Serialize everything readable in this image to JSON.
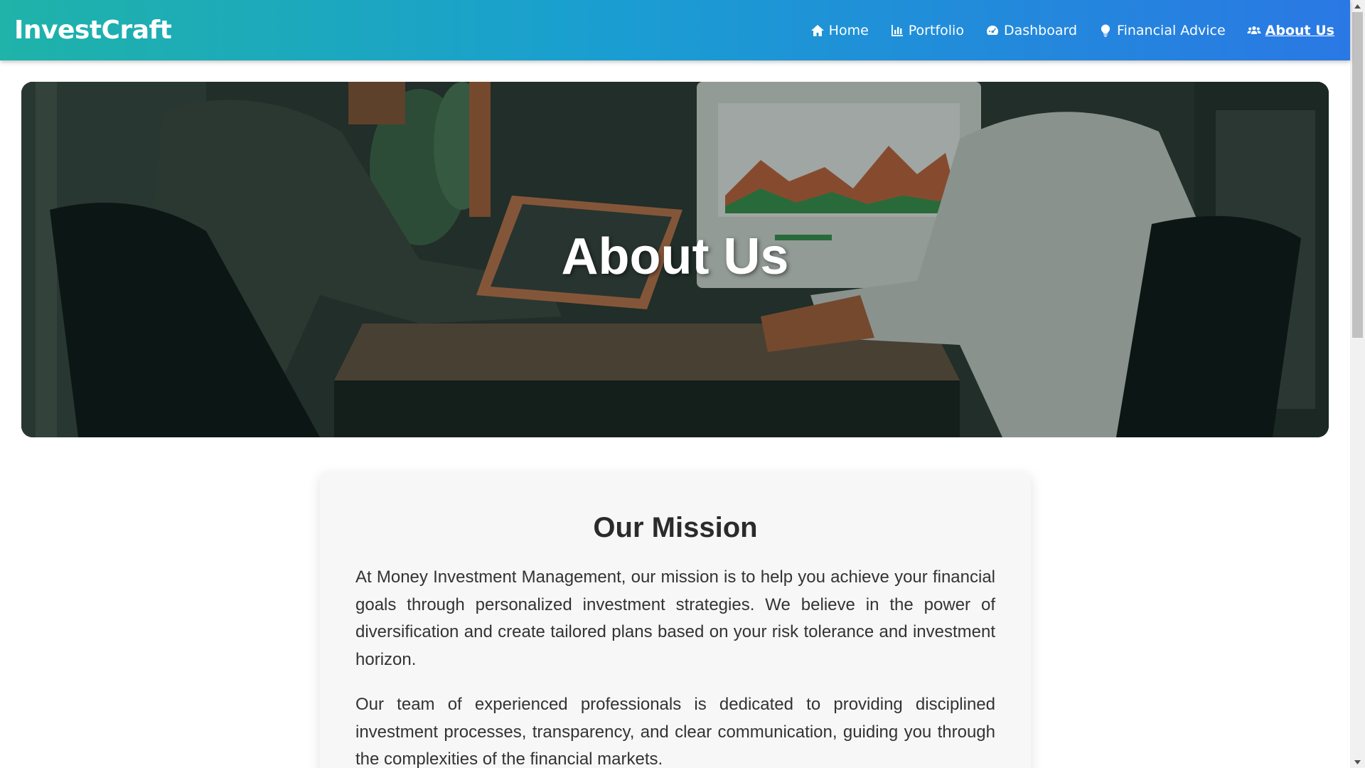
{
  "brand": "InvestCraft",
  "nav": [
    {
      "label": "Home",
      "icon": "home-icon"
    },
    {
      "label": "Portfolio",
      "icon": "chart-bar-icon"
    },
    {
      "label": "Dashboard",
      "icon": "tachometer-icon"
    },
    {
      "label": "Financial Advice",
      "icon": "lightbulb-icon"
    },
    {
      "label": "About Us",
      "icon": "users-icon",
      "active": true
    }
  ],
  "hero": {
    "title": "About Us",
    "image": "illustration-two-advisors-at-desk-icon"
  },
  "mission": {
    "title": "Our Mission",
    "paragraphs": [
      "At Money Investment Management, our mission is to help you achieve your financial goals through personalized investment strategies. We believe in the power of diversification and create tailored plans based on your risk tolerance and investment horizon.",
      "Our team of experienced professionals is dedicated to providing disciplined investment processes, transparency, and clear communication, guiding you through the complexities of the financial markets."
    ]
  },
  "colors": {
    "nav_gradient_start": "#1fb3a9",
    "nav_gradient_end": "#2a78e4",
    "card_bg": "#f7f7f7"
  }
}
